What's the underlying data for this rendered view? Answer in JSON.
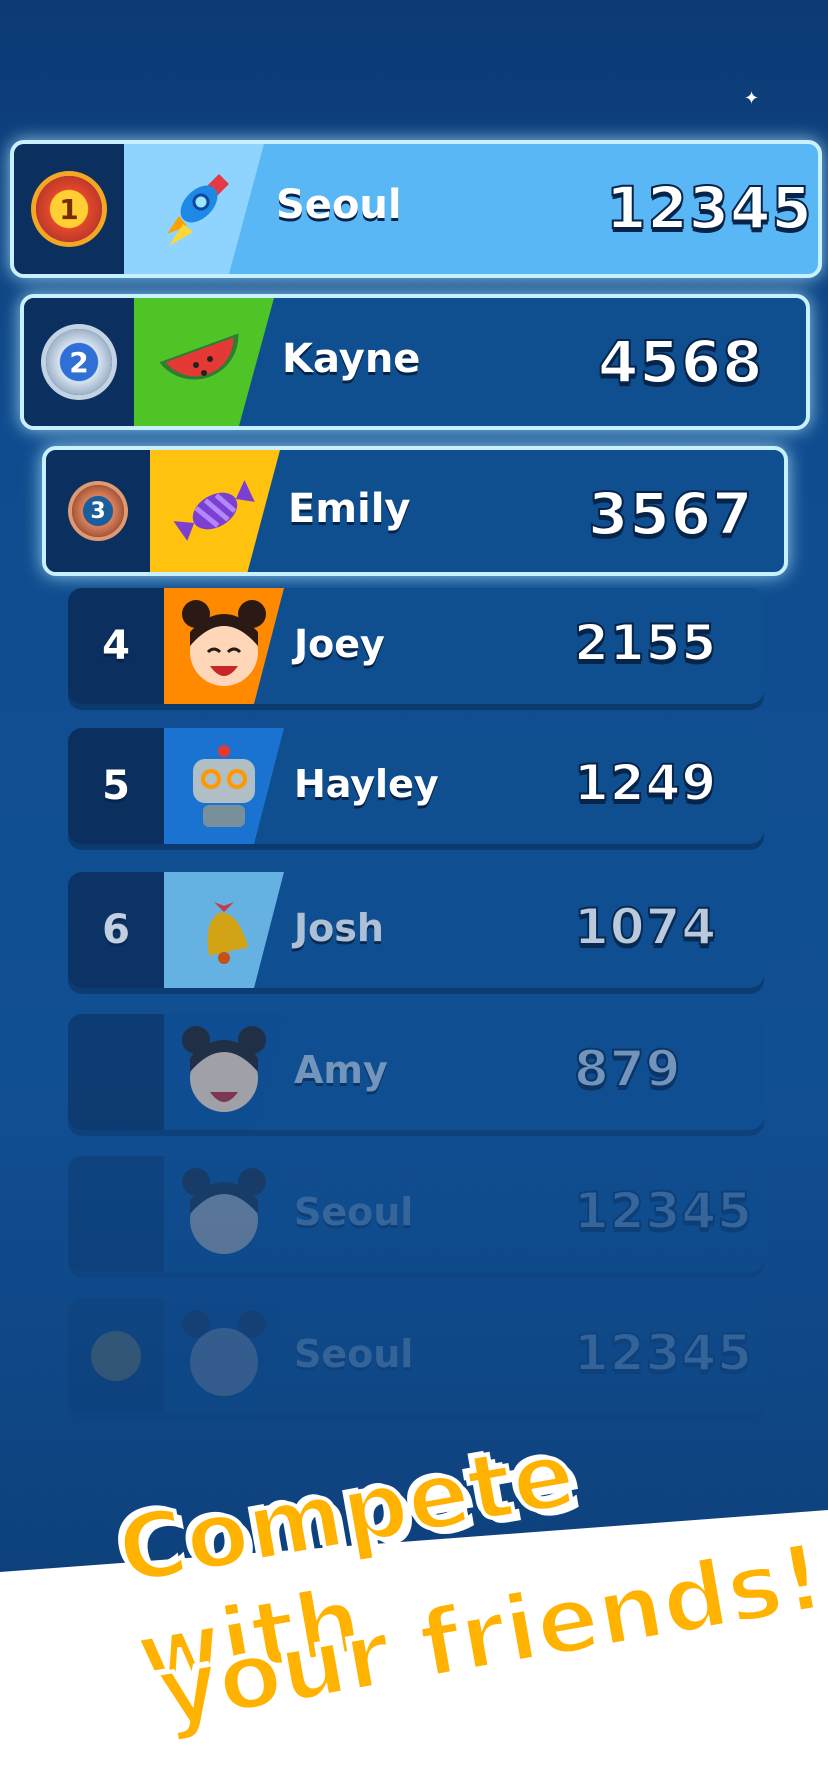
{
  "leaderboard": [
    {
      "rank": "1",
      "name": "Seoul",
      "score": "12345",
      "avatar": "rocket-icon",
      "medal": "gold"
    },
    {
      "rank": "2",
      "name": "Kayne",
      "score": "4568",
      "avatar": "watermelon-icon",
      "medal": "silver"
    },
    {
      "rank": "3",
      "name": "Emily",
      "score": "3567",
      "avatar": "candy-icon",
      "medal": "bronze"
    },
    {
      "rank": "4",
      "name": "Joey",
      "score": "2155",
      "avatar": "girl-face-icon"
    },
    {
      "rank": "5",
      "name": "Hayley",
      "score": "1249",
      "avatar": "robot-icon"
    },
    {
      "rank": "6",
      "name": "Josh",
      "score": "1074",
      "avatar": "bell-icon"
    },
    {
      "rank": "",
      "name": "Amy",
      "score": "879",
      "avatar": "girl-face-icon"
    },
    {
      "rank": "",
      "name": "Seoul",
      "score": "12345",
      "avatar": "girl-face-icon"
    },
    {
      "rank": "",
      "name": "Seoul",
      "score": "12345",
      "avatar": "girl-face-icon",
      "medal": "gold"
    }
  ],
  "banner": {
    "line1": "Compete with",
    "line2": "your friends!"
  },
  "colors": {
    "accent": "#ffb300",
    "row_top": "#5ab7f5",
    "avatar_1": "#8fd3ff",
    "avatar_2": "#4ec426",
    "avatar_3": "#ffc20e",
    "avatar_4": "#ff8a00",
    "avatar_5": "#1a73d0",
    "avatar_6": "#74c3f0"
  }
}
